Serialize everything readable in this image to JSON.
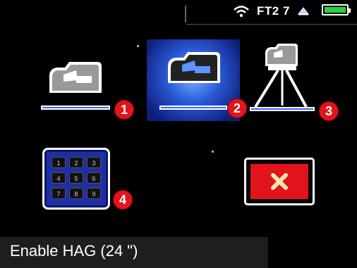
{
  "status_bar": {
    "label": "FT2 7",
    "wifi_icon": "wifi-icon",
    "triangle_icon": "triangle-icon",
    "battery_icon": "battery-icon",
    "battery_level": 1.0,
    "battery_color": "#28d23c"
  },
  "options": [
    {
      "badge": "1",
      "icon": "instrument-icon",
      "selected": false
    },
    {
      "badge": "2",
      "icon": "instrument-icon",
      "selected": true
    },
    {
      "badge": "3",
      "icon": "tripod-instrument-icon",
      "selected": false
    },
    {
      "badge": "4",
      "icon": "keypad-icon",
      "selected": false
    }
  ],
  "keypad": {
    "keys": [
      "1",
      "2",
      "3",
      "4",
      "5",
      "6",
      "7",
      "8",
      "9"
    ]
  },
  "close_button": {
    "icon": "close-icon"
  },
  "footer": {
    "text": "Enable HAG  (24 \")"
  },
  "colors": {
    "accent_blue": "#3a66ff",
    "badge_red": "#e2141c",
    "close_red": "#e0141a",
    "selected_bg": "#2a5cd8"
  }
}
